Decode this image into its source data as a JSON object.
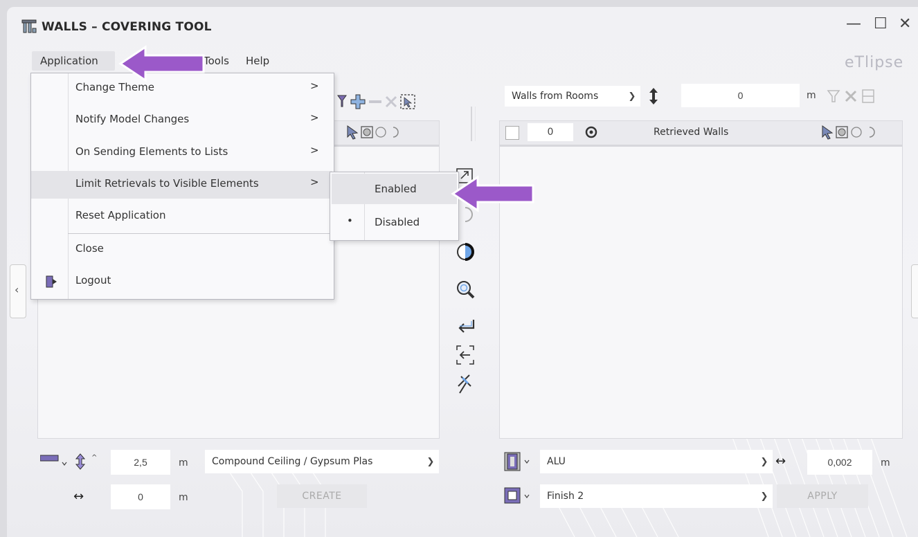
{
  "window": {
    "title": "WALLS – COVERING TOOL",
    "brand": "eTlipse",
    "controls": {
      "minimize": "—",
      "maximize": "☐",
      "close": "✕"
    }
  },
  "menubar": {
    "items": [
      "Application",
      "Tools",
      "Help"
    ]
  },
  "app_menu": {
    "items": [
      {
        "label": "Change Theme",
        "submenu": true
      },
      {
        "label": "Notify Model Changes",
        "submenu": true
      },
      {
        "label": "On Sending Elements to Lists",
        "submenu": true
      },
      {
        "label": "Limit Retrievals to Visible Elements",
        "submenu": true
      },
      {
        "label": "Reset Application",
        "submenu": false
      },
      {
        "label": "Close",
        "submenu": false
      },
      {
        "label": "Logout",
        "submenu": false,
        "icon": "logout-icon"
      }
    ],
    "arrow_glyph": ">",
    "submenu": {
      "items": [
        {
          "label": "Enabled",
          "selected": false
        },
        {
          "label": "Disabled",
          "selected": true
        }
      ],
      "bullet": "•"
    }
  },
  "right_panel": {
    "source_combo": "Walls from Rooms",
    "offset_value": "0",
    "offset_unit": "m",
    "header": {
      "count": "0",
      "title": "Retrieved Walls"
    }
  },
  "left_bottom": {
    "height_value": "2,5",
    "height_unit": "m",
    "ceiling_type": "Compound Ceiling / Gypsum Plas",
    "offset_value": "0",
    "offset_unit": "m",
    "create_label": "CREATE"
  },
  "right_bottom": {
    "material": "ALU",
    "thickness_value": "0,002",
    "thickness_unit": "m",
    "finish": "Finish 2",
    "apply_label": "APPLY"
  },
  "colors": {
    "accent_purple": "#9b59c9",
    "panel_bg": "#f7f7f9",
    "header_bg": "#eaeaee"
  }
}
